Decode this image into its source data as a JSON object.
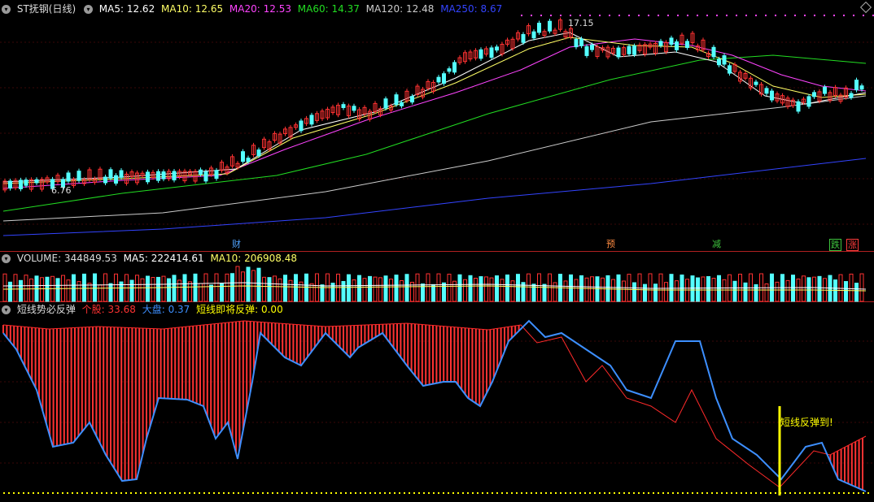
{
  "price_header": {
    "title": "ST抚钢(日线)",
    "ma5": "MA5: 12.62",
    "ma10": "MA10: 12.65",
    "ma20": "MA20: 12.53",
    "ma60": "MA60: 14.37",
    "ma120": "MA120: 12.48",
    "ma250": "MA250: 8.67"
  },
  "price_panel": {
    "high_label": "17.15",
    "low_label": "6.76"
  },
  "event_markers": [
    {
      "label": "财",
      "color": "#4fa3ff"
    },
    {
      "label": "预",
      "color": "#ff8c42"
    },
    {
      "label": "减",
      "color": "#3ec43e"
    },
    {
      "label": "跌",
      "color": "#3ec43e"
    },
    {
      "label": "涨",
      "color": "#ff3b3b"
    }
  ],
  "volume_header": {
    "name": "VOLUME: 344849.53",
    "ma5": "MA5: 222414.61",
    "ma10": "MA10: 206908.48"
  },
  "indicator_header": {
    "name": "短线势必反弹",
    "stock": "个股: 33.68",
    "market": "大盘: 0.37",
    "signal": "短线即将反弹: 0.00"
  },
  "indicator_panel": {
    "signal_label": "短线反弹到!"
  },
  "colors": {
    "up": "#ff3232",
    "down": "#54ffff",
    "ma5": "#ffffff",
    "ma10": "#ffff66",
    "ma20": "#ff44ff",
    "ma60": "#22dd22",
    "ma120": "#cccccc",
    "ma250": "#3344ff",
    "stock_line": "#ff2a2a",
    "market_line": "#3d8fff",
    "signal": "#ffff00"
  }
}
